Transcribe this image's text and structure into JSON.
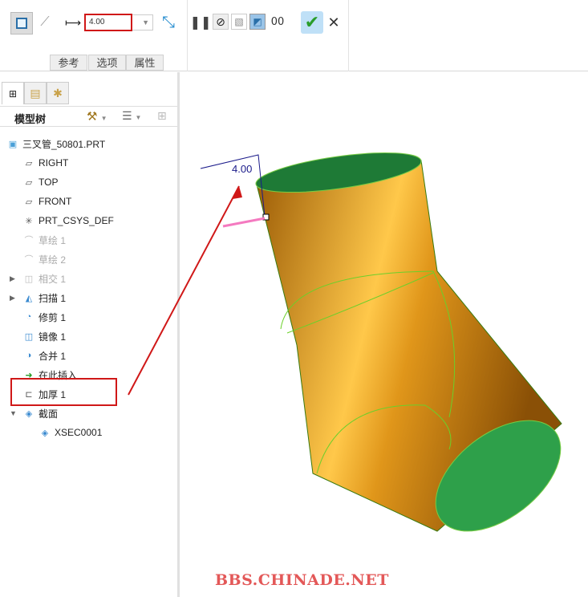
{
  "ribbon": {
    "thickness_value": "4.00",
    "tabs": [
      "参考",
      "选项",
      "属性"
    ]
  },
  "tree": {
    "title": "模型树",
    "items": [
      {
        "label": "三叉管_50801.PRT",
        "icon": "part-icon",
        "state": "normal"
      },
      {
        "label": "RIGHT",
        "icon": "datum-plane-icon",
        "state": "normal"
      },
      {
        "label": "TOP",
        "icon": "datum-plane-icon",
        "state": "normal"
      },
      {
        "label": "FRONT",
        "icon": "datum-plane-icon",
        "state": "normal"
      },
      {
        "label": "PRT_CSYS_DEF",
        "icon": "csys-icon",
        "state": "normal"
      },
      {
        "label": "草绘 1",
        "icon": "sketch-icon",
        "state": "disabled"
      },
      {
        "label": "草绘 2",
        "icon": "sketch-icon",
        "state": "disabled"
      },
      {
        "label": "相交 1",
        "icon": "intersect-icon",
        "state": "disabled"
      },
      {
        "label": "扫描 1",
        "icon": "sweep-icon",
        "state": "normal"
      },
      {
        "label": "修剪 1",
        "icon": "trim-icon",
        "state": "normal"
      },
      {
        "label": "镜像 1",
        "icon": "mirror-icon",
        "state": "normal"
      },
      {
        "label": "合并 1",
        "icon": "merge-icon",
        "state": "normal"
      },
      {
        "label": "在此插入",
        "icon": "insert-here-icon",
        "state": "normal"
      },
      {
        "label": "加厚 1",
        "icon": "thicken-icon",
        "state": "active"
      },
      {
        "label": "截面",
        "icon": "section-icon",
        "state": "normal"
      },
      {
        "label": "XSEC0001",
        "icon": "xsec-icon",
        "state": "normal"
      }
    ]
  },
  "viewport": {
    "dimension_label": "4.00"
  },
  "watermark": "BBS.CHINADE.NET",
  "colors": {
    "highlight": "#d01818",
    "surface": "#d98a10",
    "inner": "#1f8a3a"
  }
}
